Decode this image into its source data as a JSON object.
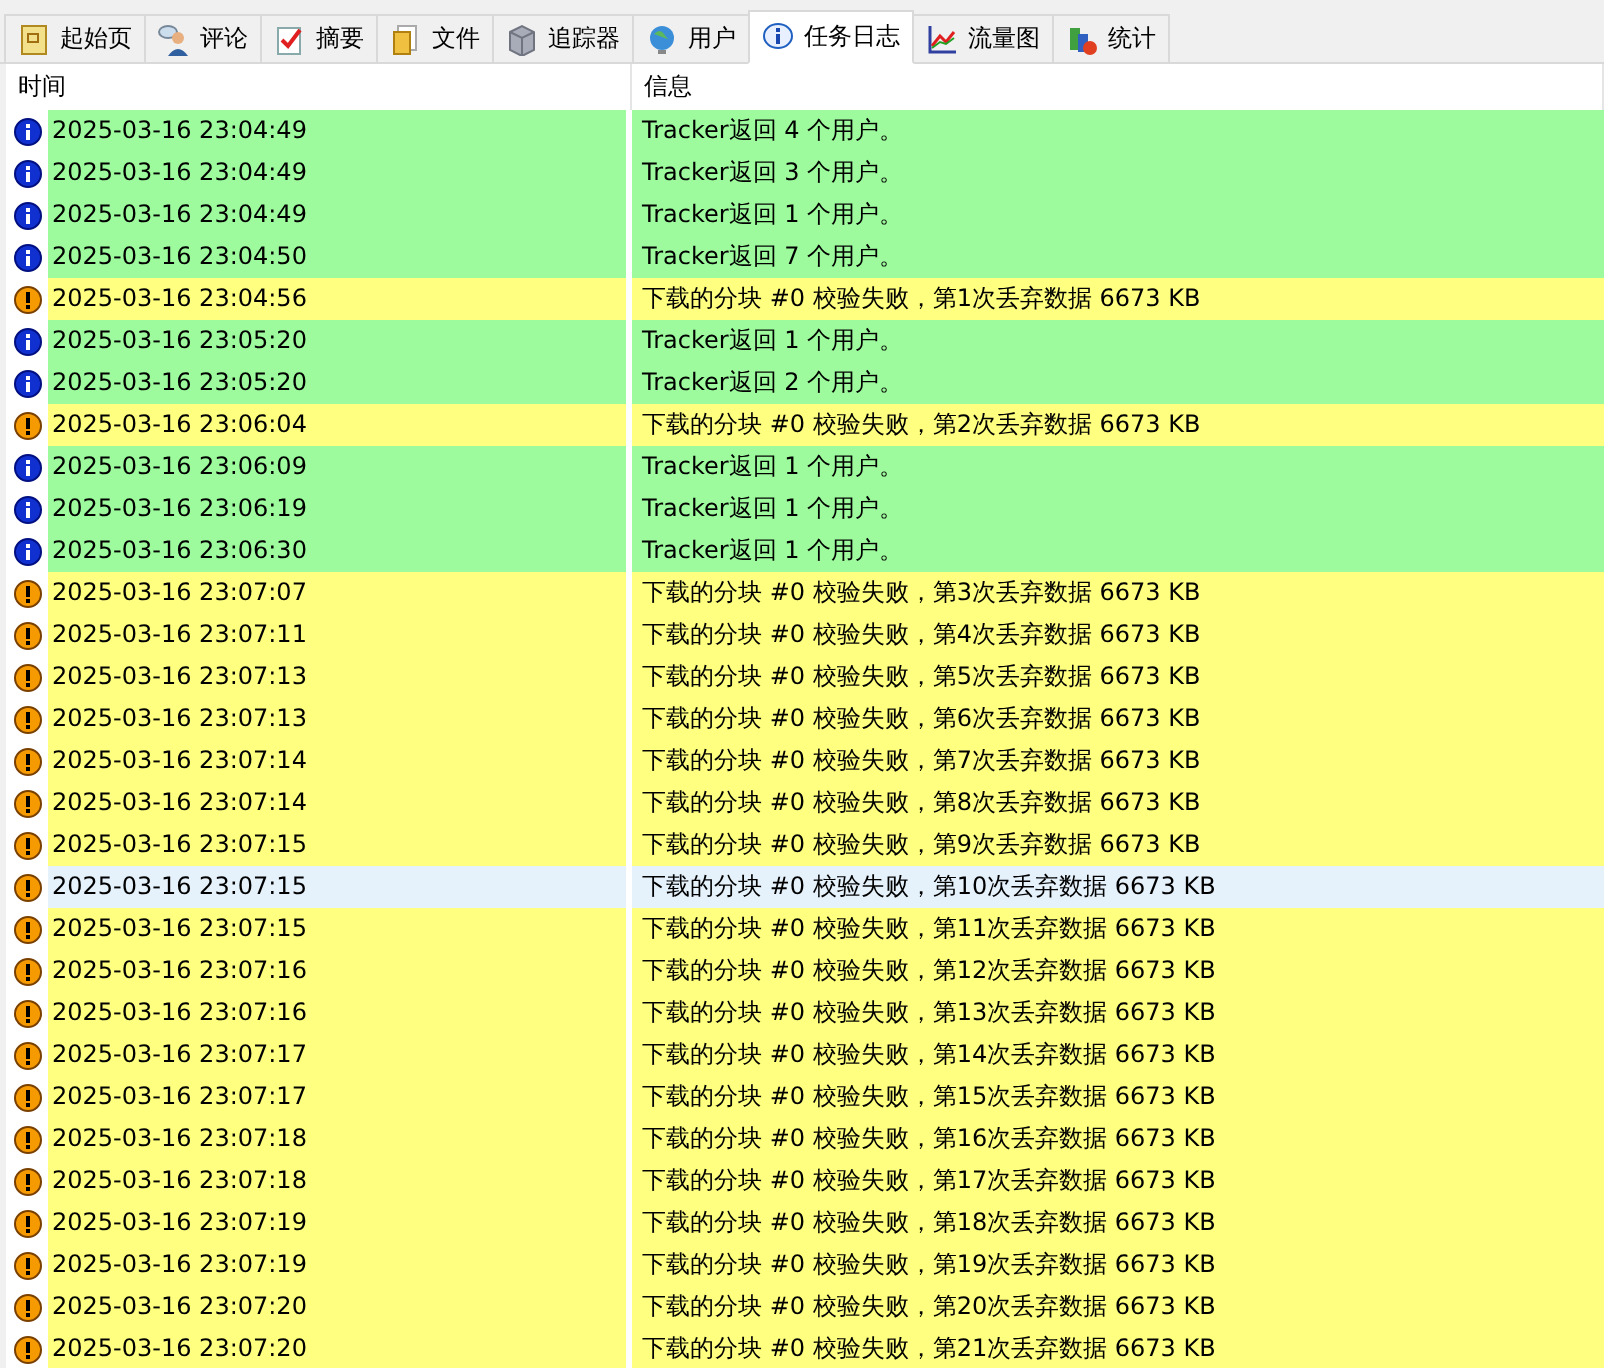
{
  "tabs": [
    {
      "label": "起始页",
      "selected": false
    },
    {
      "label": "评论",
      "selected": false
    },
    {
      "label": "摘要",
      "selected": false
    },
    {
      "label": "文件",
      "selected": false
    },
    {
      "label": "追踪器",
      "selected": false
    },
    {
      "label": "用户",
      "selected": false
    },
    {
      "label": "任务日志",
      "selected": true
    },
    {
      "label": "流量图",
      "selected": false
    },
    {
      "label": "统计",
      "selected": false
    }
  ],
  "table": {
    "columns": [
      "时间",
      "信息"
    ],
    "rows": [
      {
        "kind": "info",
        "selected": false,
        "time": "2025-03-16 23:04:49",
        "message": "Tracker返回 4 个用户。"
      },
      {
        "kind": "info",
        "selected": false,
        "time": "2025-03-16 23:04:49",
        "message": "Tracker返回 3 个用户。"
      },
      {
        "kind": "info",
        "selected": false,
        "time": "2025-03-16 23:04:49",
        "message": "Tracker返回 1 个用户。"
      },
      {
        "kind": "info",
        "selected": false,
        "time": "2025-03-16 23:04:50",
        "message": "Tracker返回 7 个用户。"
      },
      {
        "kind": "warning",
        "selected": false,
        "time": "2025-03-16 23:04:56",
        "message": "下载的分块 #0 校验失败，第1次丢弃数据 6673 KB"
      },
      {
        "kind": "info",
        "selected": false,
        "time": "2025-03-16 23:05:20",
        "message": "Tracker返回 1 个用户。"
      },
      {
        "kind": "info",
        "selected": false,
        "time": "2025-03-16 23:05:20",
        "message": "Tracker返回 2 个用户。"
      },
      {
        "kind": "warning",
        "selected": false,
        "time": "2025-03-16 23:06:04",
        "message": "下载的分块 #0 校验失败，第2次丢弃数据 6673 KB"
      },
      {
        "kind": "info",
        "selected": false,
        "time": "2025-03-16 23:06:09",
        "message": "Tracker返回 1 个用户。"
      },
      {
        "kind": "info",
        "selected": false,
        "time": "2025-03-16 23:06:19",
        "message": "Tracker返回 1 个用户。"
      },
      {
        "kind": "info",
        "selected": false,
        "time": "2025-03-16 23:06:30",
        "message": "Tracker返回 1 个用户。"
      },
      {
        "kind": "warning",
        "selected": false,
        "time": "2025-03-16 23:07:07",
        "message": "下载的分块 #0 校验失败，第3次丢弃数据 6673 KB"
      },
      {
        "kind": "warning",
        "selected": false,
        "time": "2025-03-16 23:07:11",
        "message": "下载的分块 #0 校验失败，第4次丢弃数据 6673 KB"
      },
      {
        "kind": "warning",
        "selected": false,
        "time": "2025-03-16 23:07:13",
        "message": "下载的分块 #0 校验失败，第5次丢弃数据 6673 KB"
      },
      {
        "kind": "warning",
        "selected": false,
        "time": "2025-03-16 23:07:13",
        "message": "下载的分块 #0 校验失败，第6次丢弃数据 6673 KB"
      },
      {
        "kind": "warning",
        "selected": false,
        "time": "2025-03-16 23:07:14",
        "message": "下载的分块 #0 校验失败，第7次丢弃数据 6673 KB"
      },
      {
        "kind": "warning",
        "selected": false,
        "time": "2025-03-16 23:07:14",
        "message": "下载的分块 #0 校验失败，第8次丢弃数据 6673 KB"
      },
      {
        "kind": "warning",
        "selected": false,
        "time": "2025-03-16 23:07:15",
        "message": "下载的分块 #0 校验失败，第9次丢弃数据 6673 KB"
      },
      {
        "kind": "warning",
        "selected": true,
        "time": "2025-03-16 23:07:15",
        "message": "下载的分块 #0 校验失败，第10次丢弃数据 6673 KB"
      },
      {
        "kind": "warning",
        "selected": false,
        "time": "2025-03-16 23:07:15",
        "message": "下载的分块 #0 校验失败，第11次丢弃数据 6673 KB"
      },
      {
        "kind": "warning",
        "selected": false,
        "time": "2025-03-16 23:07:16",
        "message": "下载的分块 #0 校验失败，第12次丢弃数据 6673 KB"
      },
      {
        "kind": "warning",
        "selected": false,
        "time": "2025-03-16 23:07:16",
        "message": "下载的分块 #0 校验失败，第13次丢弃数据 6673 KB"
      },
      {
        "kind": "warning",
        "selected": false,
        "time": "2025-03-16 23:07:17",
        "message": "下载的分块 #0 校验失败，第14次丢弃数据 6673 KB"
      },
      {
        "kind": "warning",
        "selected": false,
        "time": "2025-03-16 23:07:17",
        "message": "下载的分块 #0 校验失败，第15次丢弃数据 6673 KB"
      },
      {
        "kind": "warning",
        "selected": false,
        "time": "2025-03-16 23:07:18",
        "message": "下载的分块 #0 校验失败，第16次丢弃数据 6673 KB"
      },
      {
        "kind": "warning",
        "selected": false,
        "time": "2025-03-16 23:07:18",
        "message": "下载的分块 #0 校验失败，第17次丢弃数据 6673 KB"
      },
      {
        "kind": "warning",
        "selected": false,
        "time": "2025-03-16 23:07:19",
        "message": "下载的分块 #0 校验失败，第18次丢弃数据 6673 KB"
      },
      {
        "kind": "warning",
        "selected": false,
        "time": "2025-03-16 23:07:19",
        "message": "下载的分块 #0 校验失败，第19次丢弃数据 6673 KB"
      },
      {
        "kind": "warning",
        "selected": false,
        "time": "2025-03-16 23:07:20",
        "message": "下载的分块 #0 校验失败，第20次丢弃数据 6673 KB"
      },
      {
        "kind": "warning",
        "selected": false,
        "time": "2025-03-16 23:07:20",
        "message": "下载的分块 #0 校验失败，第21次丢弃数据 6673 KB"
      }
    ]
  }
}
